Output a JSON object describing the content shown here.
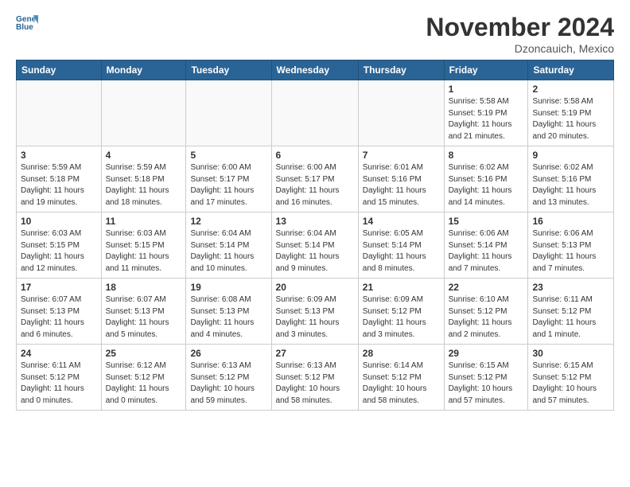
{
  "header": {
    "logo_line1": "General",
    "logo_line2": "Blue",
    "month": "November 2024",
    "location": "Dzoncauich, Mexico"
  },
  "weekdays": [
    "Sunday",
    "Monday",
    "Tuesday",
    "Wednesday",
    "Thursday",
    "Friday",
    "Saturday"
  ],
  "weeks": [
    [
      {
        "day": "",
        "info": ""
      },
      {
        "day": "",
        "info": ""
      },
      {
        "day": "",
        "info": ""
      },
      {
        "day": "",
        "info": ""
      },
      {
        "day": "",
        "info": ""
      },
      {
        "day": "1",
        "info": "Sunrise: 5:58 AM\nSunset: 5:19 PM\nDaylight: 11 hours\nand 21 minutes."
      },
      {
        "day": "2",
        "info": "Sunrise: 5:58 AM\nSunset: 5:19 PM\nDaylight: 11 hours\nand 20 minutes."
      }
    ],
    [
      {
        "day": "3",
        "info": "Sunrise: 5:59 AM\nSunset: 5:18 PM\nDaylight: 11 hours\nand 19 minutes."
      },
      {
        "day": "4",
        "info": "Sunrise: 5:59 AM\nSunset: 5:18 PM\nDaylight: 11 hours\nand 18 minutes."
      },
      {
        "day": "5",
        "info": "Sunrise: 6:00 AM\nSunset: 5:17 PM\nDaylight: 11 hours\nand 17 minutes."
      },
      {
        "day": "6",
        "info": "Sunrise: 6:00 AM\nSunset: 5:17 PM\nDaylight: 11 hours\nand 16 minutes."
      },
      {
        "day": "7",
        "info": "Sunrise: 6:01 AM\nSunset: 5:16 PM\nDaylight: 11 hours\nand 15 minutes."
      },
      {
        "day": "8",
        "info": "Sunrise: 6:02 AM\nSunset: 5:16 PM\nDaylight: 11 hours\nand 14 minutes."
      },
      {
        "day": "9",
        "info": "Sunrise: 6:02 AM\nSunset: 5:16 PM\nDaylight: 11 hours\nand 13 minutes."
      }
    ],
    [
      {
        "day": "10",
        "info": "Sunrise: 6:03 AM\nSunset: 5:15 PM\nDaylight: 11 hours\nand 12 minutes."
      },
      {
        "day": "11",
        "info": "Sunrise: 6:03 AM\nSunset: 5:15 PM\nDaylight: 11 hours\nand 11 minutes."
      },
      {
        "day": "12",
        "info": "Sunrise: 6:04 AM\nSunset: 5:14 PM\nDaylight: 11 hours\nand 10 minutes."
      },
      {
        "day": "13",
        "info": "Sunrise: 6:04 AM\nSunset: 5:14 PM\nDaylight: 11 hours\nand 9 minutes."
      },
      {
        "day": "14",
        "info": "Sunrise: 6:05 AM\nSunset: 5:14 PM\nDaylight: 11 hours\nand 8 minutes."
      },
      {
        "day": "15",
        "info": "Sunrise: 6:06 AM\nSunset: 5:14 PM\nDaylight: 11 hours\nand 7 minutes."
      },
      {
        "day": "16",
        "info": "Sunrise: 6:06 AM\nSunset: 5:13 PM\nDaylight: 11 hours\nand 7 minutes."
      }
    ],
    [
      {
        "day": "17",
        "info": "Sunrise: 6:07 AM\nSunset: 5:13 PM\nDaylight: 11 hours\nand 6 minutes."
      },
      {
        "day": "18",
        "info": "Sunrise: 6:07 AM\nSunset: 5:13 PM\nDaylight: 11 hours\nand 5 minutes."
      },
      {
        "day": "19",
        "info": "Sunrise: 6:08 AM\nSunset: 5:13 PM\nDaylight: 11 hours\nand 4 minutes."
      },
      {
        "day": "20",
        "info": "Sunrise: 6:09 AM\nSunset: 5:13 PM\nDaylight: 11 hours\nand 3 minutes."
      },
      {
        "day": "21",
        "info": "Sunrise: 6:09 AM\nSunset: 5:12 PM\nDaylight: 11 hours\nand 3 minutes."
      },
      {
        "day": "22",
        "info": "Sunrise: 6:10 AM\nSunset: 5:12 PM\nDaylight: 11 hours\nand 2 minutes."
      },
      {
        "day": "23",
        "info": "Sunrise: 6:11 AM\nSunset: 5:12 PM\nDaylight: 11 hours\nand 1 minute."
      }
    ],
    [
      {
        "day": "24",
        "info": "Sunrise: 6:11 AM\nSunset: 5:12 PM\nDaylight: 11 hours\nand 0 minutes."
      },
      {
        "day": "25",
        "info": "Sunrise: 6:12 AM\nSunset: 5:12 PM\nDaylight: 11 hours\nand 0 minutes."
      },
      {
        "day": "26",
        "info": "Sunrise: 6:13 AM\nSunset: 5:12 PM\nDaylight: 10 hours\nand 59 minutes."
      },
      {
        "day": "27",
        "info": "Sunrise: 6:13 AM\nSunset: 5:12 PM\nDaylight: 10 hours\nand 58 minutes."
      },
      {
        "day": "28",
        "info": "Sunrise: 6:14 AM\nSunset: 5:12 PM\nDaylight: 10 hours\nand 58 minutes."
      },
      {
        "day": "29",
        "info": "Sunrise: 6:15 AM\nSunset: 5:12 PM\nDaylight: 10 hours\nand 57 minutes."
      },
      {
        "day": "30",
        "info": "Sunrise: 6:15 AM\nSunset: 5:12 PM\nDaylight: 10 hours\nand 57 minutes."
      }
    ]
  ]
}
